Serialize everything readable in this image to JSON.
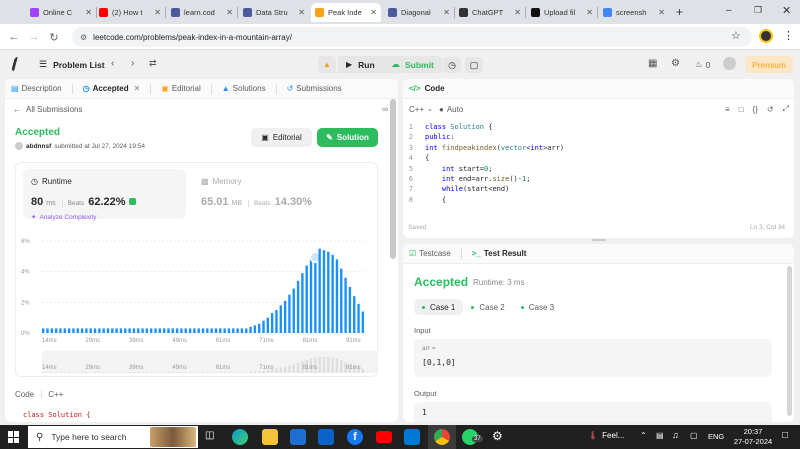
{
  "browser": {
    "tabs": [
      {
        "title": "Online C",
        "color": "#a142f4",
        "active": false
      },
      {
        "title": "(2) How t",
        "color": "#ff0000",
        "active": false
      },
      {
        "title": "learn.cod",
        "color": "#4a5a9c",
        "active": false
      },
      {
        "title": "Data Stru",
        "color": "#4a5a9c",
        "active": false
      },
      {
        "title": "Peak Inde",
        "color": "#ffa116",
        "active": true
      },
      {
        "title": "Diagonal",
        "color": "#4a5a9c",
        "active": false
      },
      {
        "title": "ChatGPT",
        "color": "#333333",
        "active": false
      },
      {
        "title": "Upload fil",
        "color": "#111111",
        "active": false
      },
      {
        "title": "screensh",
        "color": "#4285f4",
        "active": false
      }
    ],
    "url": "leetcode.com/problems/peak-index-in-a-mountain-array/"
  },
  "lc_header": {
    "problem_list": "Problem List",
    "run": "Run",
    "submit": "Submit",
    "streak": "0",
    "premium": "Premium"
  },
  "left_tabs": [
    "Description",
    "Accepted",
    "Editorial",
    "Solutions",
    "Submissions"
  ],
  "submission": {
    "back_label": "All Submissions",
    "status": "Accepted",
    "user": "abdnnsf",
    "submitted_text": "submitted at Jul 27, 2024 19:54",
    "editorial_btn": "Editorial",
    "solution_btn": "Solution",
    "runtime_label": "Runtime",
    "runtime_value": "80",
    "runtime_unit": "ms",
    "beats_label": "Beats",
    "runtime_beats": "62.22%",
    "analyze": "Analyze Complexity",
    "memory_label": "Memory",
    "memory_value": "65.01",
    "memory_unit": "MB",
    "memory_beats": "14.30%",
    "lang_tabs": [
      "Code",
      "C++"
    ],
    "code_preview": "class Solution {"
  },
  "chart_data": {
    "type": "bar",
    "yticks": [
      "6%",
      "4%",
      "2%",
      "0%"
    ],
    "ylim": [
      0,
      6
    ],
    "xticks": [
      "14ms",
      "29ms",
      "39ms",
      "49ms",
      "61ms",
      "71ms",
      "81ms",
      "91ms"
    ],
    "values": [
      0.3,
      0.3,
      0.3,
      0.3,
      0.3,
      0.3,
      0.3,
      0.3,
      0.3,
      0.3,
      0.3,
      0.3,
      0.3,
      0.3,
      0.3,
      0.3,
      0.3,
      0.3,
      0.3,
      0.3,
      0.3,
      0.3,
      0.3,
      0.3,
      0.3,
      0.3,
      0.3,
      0.3,
      0.3,
      0.3,
      0.3,
      0.3,
      0.3,
      0.3,
      0.3,
      0.3,
      0.3,
      0.3,
      0.3,
      0.3,
      0.3,
      0.3,
      0.3,
      0.3,
      0.3,
      0.3,
      0.3,
      0.3,
      0.4,
      0.5,
      0.6,
      0.8,
      1.0,
      1.3,
      1.5,
      1.8,
      2.1,
      2.5,
      2.9,
      3.4,
      3.9,
      4.4,
      4.9,
      5.2,
      5.5,
      5.4,
      5.3,
      5.1,
      4.8,
      4.2,
      3.6,
      3.0,
      2.4,
      1.9,
      1.4
    ],
    "highlight_index": 63
  },
  "code_editor": {
    "title": "Code",
    "lang": "C++",
    "auto": "Auto",
    "lines": [
      {
        "n": "1",
        "html": "<span class='kw'>class</span> <span class='ty'>Solution</span> {"
      },
      {
        "n": "2",
        "html": "<span class='kw'>public</span>:"
      },
      {
        "n": "3",
        "html": "<span class='kw'>int</span> <span class='fn'>findpeakindex</span>(<span class='ty'>vector</span>&lt;<span class='kw'>int</span>&gt;arr)"
      },
      {
        "n": "4",
        "html": "{"
      },
      {
        "n": "5",
        "html": "    <span class='kw'>int</span> start=<span class='nm'>0</span>;"
      },
      {
        "n": "6",
        "html": "    <span class='kw'>int</span> end=arr.<span class='fn'>size</span>()-<span class='nm'>1</span>;"
      },
      {
        "n": "7",
        "html": "    <span class='kw'>while</span>(start&lt;end)"
      },
      {
        "n": "8",
        "html": "    {"
      }
    ],
    "saved": "Saved",
    "cursor": "Ln 3, Col 34"
  },
  "test": {
    "tab1": "Testcase",
    "tab2": "Test Result",
    "status": "Accepted",
    "runtime": "Runtime: 3 ms",
    "cases": [
      "Case 1",
      "Case 2",
      "Case 3"
    ],
    "input_label": "Input",
    "var_label": "arr =",
    "input_value": "[0,1,0]",
    "output_label": "Output",
    "output_value": "1"
  },
  "taskbar": {
    "search_placeholder": "Type here to search",
    "weather": "Feel...",
    "lang": "ENG",
    "time": "20:37",
    "date": "27-07-2024",
    "badge": "37"
  }
}
